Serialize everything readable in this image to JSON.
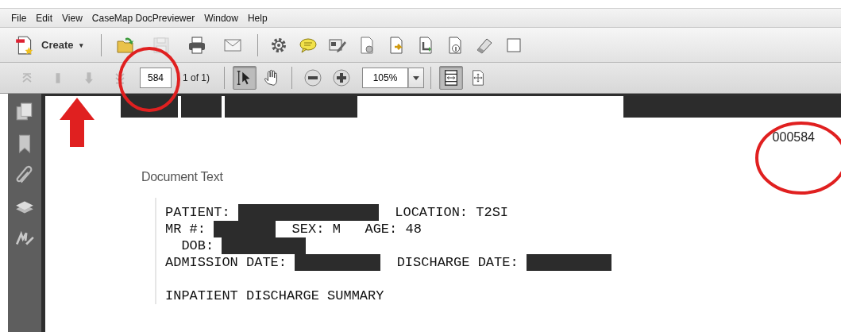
{
  "menu": [
    {
      "label": "File"
    },
    {
      "label": "Edit"
    },
    {
      "label": "View"
    },
    {
      "label": "CaseMap DocPreviewer"
    },
    {
      "label": "Window"
    },
    {
      "label": "Help"
    }
  ],
  "toolbar": {
    "create": {
      "label": "Create",
      "caret": "▾"
    },
    "tools": [
      {
        "kind": "open",
        "disabled": false
      },
      {
        "kind": "save",
        "disabled": true
      },
      {
        "kind": "print",
        "disabled": false
      },
      {
        "kind": "email",
        "disabled": false
      },
      {
        "kind": "separator"
      },
      {
        "kind": "gear",
        "disabled": false
      },
      {
        "kind": "comment",
        "disabled": false
      },
      {
        "kind": "sign",
        "disabled": false
      },
      {
        "kind": "doc-gear",
        "disabled": false
      },
      {
        "kind": "doc-export",
        "disabled": false
      },
      {
        "kind": "doc-import",
        "disabled": false
      },
      {
        "kind": "doc-info",
        "disabled": false
      },
      {
        "kind": "eraser",
        "disabled": false
      },
      {
        "kind": "square",
        "disabled": false
      }
    ]
  },
  "navigation": {
    "buttons": [
      {
        "kind": "first",
        "disabled": true
      },
      {
        "kind": "prev",
        "disabled": true
      },
      {
        "kind": "next",
        "disabled": true
      },
      {
        "kind": "last",
        "disabled": true
      }
    ],
    "page_field": {
      "value": "584"
    },
    "page_count": "1 of 1)",
    "tools": [
      {
        "kind": "select",
        "selected": true
      },
      {
        "kind": "hand",
        "selected": false
      }
    ],
    "zoom_out": {
      "kind": "zoom-out"
    },
    "zoom_in": {
      "kind": "zoom-in"
    },
    "zoom_field": {
      "value": "105%"
    },
    "view_tools": [
      {
        "kind": "fit-width",
        "selected": true
      },
      {
        "kind": "fit-page",
        "selected": false
      }
    ]
  },
  "sidebar": [
    {
      "kind": "pages"
    },
    {
      "kind": "bookmark"
    },
    {
      "kind": "paperclip"
    },
    {
      "kind": "layers"
    },
    {
      "kind": "signature"
    }
  ],
  "document": {
    "bates_number": "000584",
    "heading": "Document Text",
    "paragraphs": [
      {
        "lines": [
          [
            {
              "kind": "text",
              "text": "PATIENT: "
            },
            {
              "kind": "redacted"
            },
            {
              "kind": "text",
              "text": "  LOCATION: T2SI"
            }
          ],
          [
            {
              "kind": "text",
              "text": "MR #: "
            },
            {
              "kind": "redacted"
            },
            {
              "kind": "text",
              "text": "  SEX: M   AGE: 48"
            }
          ],
          [
            {
              "kind": "text",
              "text": "  DOB: "
            },
            {
              "kind": "redacted"
            }
          ],
          [
            {
              "kind": "text",
              "text": "ADMISSION DATE: "
            },
            {
              "kind": "redacted"
            },
            {
              "kind": "text",
              "text": "  DISCHARGE DATE: "
            },
            {
              "kind": "redacted"
            }
          ]
        ]
      },
      {
        "lines": [
          [
            {
              "kind": "text",
              "text": "INPATIENT DISCHARGE SUMMARY"
            }
          ]
        ]
      }
    ]
  },
  "annotations": [
    {
      "kind": "circle",
      "color": "#e02020"
    },
    {
      "kind": "arrow",
      "color": "#e02020"
    },
    {
      "kind": "circle",
      "color": "#e02020"
    }
  ]
}
